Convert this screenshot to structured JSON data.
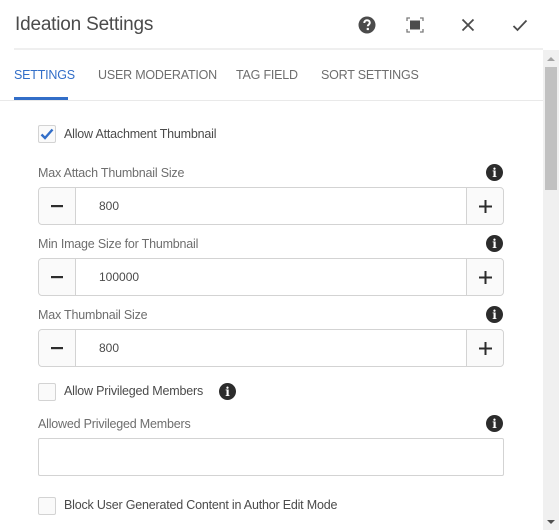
{
  "header": {
    "title": "Ideation Settings",
    "actions": [
      {
        "name": "help",
        "icon": "help-icon"
      },
      {
        "name": "fullscreen",
        "icon": "fullscreen-icon"
      },
      {
        "name": "cancel",
        "icon": "close-icon"
      },
      {
        "name": "done",
        "icon": "check-icon"
      }
    ]
  },
  "tabs": [
    {
      "label": "SETTINGS",
      "active": true
    },
    {
      "label": "USER MODERATION",
      "active": false
    },
    {
      "label": "TAG FIELD",
      "active": false
    },
    {
      "label": "SORT SETTINGS",
      "active": false
    }
  ],
  "form": {
    "allow_attachment_thumbnail": {
      "label": "Allow Attachment Thumbnail",
      "checked": true
    },
    "max_attach_thumbnail_size": {
      "label": "Max Attach Thumbnail Size",
      "value": "800",
      "minus": "−",
      "plus": "+"
    },
    "min_image_size": {
      "label": "Min Image Size for Thumbnail",
      "value": "100000",
      "minus": "−",
      "plus": "+"
    },
    "max_thumbnail_size": {
      "label": "Max Thumbnail Size",
      "value": "800",
      "minus": "−",
      "plus": "+"
    },
    "allow_privileged_members": {
      "label": "Allow Privileged Members",
      "checked": false
    },
    "allowed_privileged_members": {
      "label": "Allowed Privileged Members",
      "value": "",
      "placeholder": ""
    },
    "block_ugc_author_edit": {
      "label": "Block User Generated Content in Author Edit Mode",
      "checked": false
    }
  },
  "info_glyph": "i",
  "colors": {
    "accent": "#326ec8",
    "text": "#4b4b4b",
    "muted": "#6e6e6e",
    "icon": "#2c2c2c"
  }
}
